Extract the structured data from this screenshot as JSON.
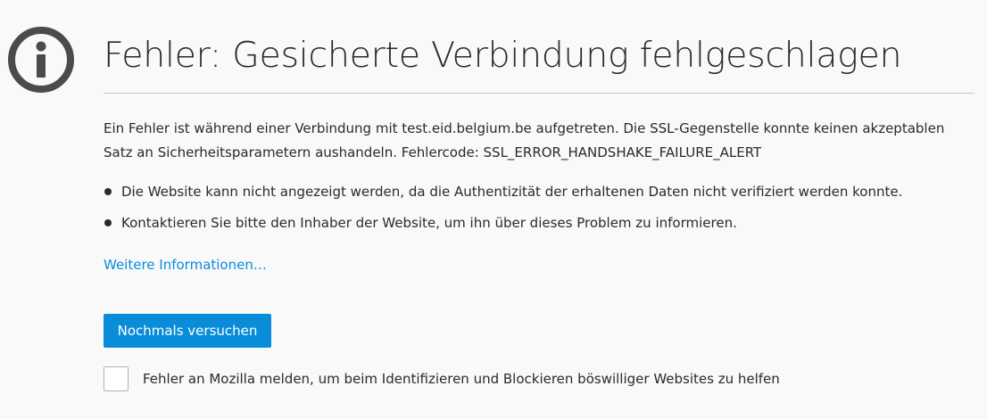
{
  "error_page": {
    "icon": "info-icon",
    "title": "Fehler: Gesicherte Verbindung fehlgeschlagen",
    "description": "Ein Fehler ist während einer Verbindung mit test.eid.belgium.be aufgetreten. Die SSL-Gegenstelle konnte keinen akzeptablen Satz an Sicherheitsparametern aushandeln. Fehlercode: SSL_ERROR_HANDSHAKE_FAILURE_ALERT",
    "bullets": [
      "Die Website kann nicht angezeigt werden, da die Authentizität der erhaltenen Daten nicht verifiziert werden konnte.",
      "Kontaktieren Sie bitte den Inhaber der Website, um ihn über dieses Problem zu informieren."
    ],
    "learn_more": "Weitere Informationen…",
    "retry_button": "Nochmals versuchen",
    "report_checkbox_label": "Fehler an Mozilla melden, um beim Identifizieren und Blockieren böswilliger Websites zu helfen",
    "report_checked": false
  },
  "colors": {
    "background": "#f9f9fa",
    "text": "#2a2a2e",
    "icon": "#4a4a4f",
    "accent": "#0a8dd9",
    "divider": "#c8c8cc"
  }
}
